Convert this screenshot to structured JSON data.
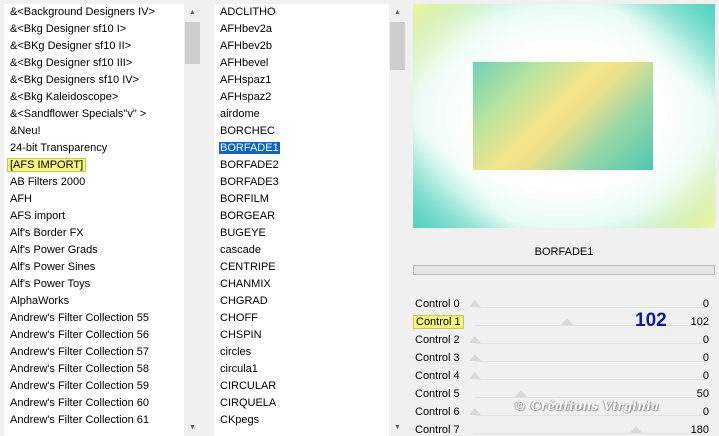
{
  "categories": [
    {
      "label": "&<Background Designers IV>"
    },
    {
      "label": "&<Bkg Designer sf10 I>"
    },
    {
      "label": "&<BKg Designer sf10 II>"
    },
    {
      "label": "&<Bkg Designer sf10 III>"
    },
    {
      "label": "&<Bkg Designers sf10 IV>"
    },
    {
      "label": "&<Bkg Kaleidoscope>"
    },
    {
      "label": "&<Sandflower Specials\"v\" >"
    },
    {
      "label": "&Neu!"
    },
    {
      "label": "24-bit Transparency"
    },
    {
      "label": "[AFS IMPORT]",
      "highlighted": true
    },
    {
      "label": "AB Filters 2000"
    },
    {
      "label": "AFH"
    },
    {
      "label": "AFS import"
    },
    {
      "label": "Alf's Border FX"
    },
    {
      "label": "Alf's Power Grads"
    },
    {
      "label": "Alf's Power Sines"
    },
    {
      "label": "Alf's Power Toys"
    },
    {
      "label": "AlphaWorks"
    },
    {
      "label": "Andrew's Filter Collection 55"
    },
    {
      "label": "Andrew's Filter Collection 56"
    },
    {
      "label": "Andrew's Filter Collection 57"
    },
    {
      "label": "Andrew's Filter Collection 58"
    },
    {
      "label": "Andrew's Filter Collection 59"
    },
    {
      "label": "Andrew's Filter Collection 60"
    },
    {
      "label": "Andrew's Filter Collection 61"
    }
  ],
  "filters": [
    {
      "label": "ADCLITHO"
    },
    {
      "label": "AFHbev2a"
    },
    {
      "label": "AFHbev2b"
    },
    {
      "label": "AFHbevel"
    },
    {
      "label": "AFHspaz1"
    },
    {
      "label": "AFHspaz2"
    },
    {
      "label": "airdome"
    },
    {
      "label": "BORCHEC"
    },
    {
      "label": "BORFADE1",
      "selected": true
    },
    {
      "label": "BORFADE2"
    },
    {
      "label": "BORFADE3"
    },
    {
      "label": "BORFILM"
    },
    {
      "label": "BORGEAR"
    },
    {
      "label": "BUGEYE"
    },
    {
      "label": "cascade"
    },
    {
      "label": "CENTRIPE"
    },
    {
      "label": "CHANMIX"
    },
    {
      "label": "CHGRAD"
    },
    {
      "label": "CHOFF"
    },
    {
      "label": "CHSPIN"
    },
    {
      "label": "circles"
    },
    {
      "label": "circula1"
    },
    {
      "label": "CIRCULAR"
    },
    {
      "label": "CIRQUELA"
    },
    {
      "label": "CKpegs"
    }
  ],
  "selected_filter_name": "BORFADE1",
  "controls": [
    {
      "label": "Control 0",
      "value": "0",
      "fraction": 0.0
    },
    {
      "label": "Control 1",
      "value": "102",
      "fraction": 0.4,
      "highlighted": true,
      "big_value": "102"
    },
    {
      "label": "Control 2",
      "value": "0",
      "fraction": 0.0
    },
    {
      "label": "Control 3",
      "value": "0",
      "fraction": 0.0
    },
    {
      "label": "Control 4",
      "value": "0",
      "fraction": 0.0
    },
    {
      "label": "Control 5",
      "value": "50",
      "fraction": 0.2
    },
    {
      "label": "Control 6",
      "value": "0",
      "fraction": 0.0
    },
    {
      "label": "Control 7",
      "value": "180",
      "fraction": 0.7
    }
  ],
  "watermark": "© Créations Virginia",
  "colors": {
    "selection": "#0a64d2",
    "highlight": "#f7f77a",
    "big_value": "#0a1ca0"
  },
  "icons": {
    "scroll_up": "triangle-up-icon",
    "scroll_down": "triangle-down-icon"
  }
}
